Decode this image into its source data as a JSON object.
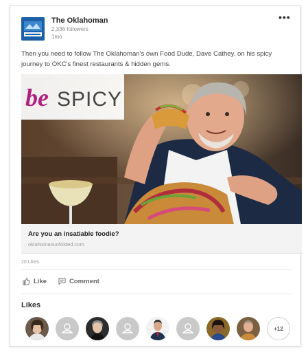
{
  "post": {
    "org_name": "The Oklahoman",
    "followers": "2,336 followers",
    "time": "1mo",
    "more_label": "•••",
    "text": "Then you need to follow The Oklahoman's own Food Dude, Dave Cathey, on his spicy journey to OKC's finest restaurants & hidden gems.",
    "logo_icon": "oklahoman-logo-icon"
  },
  "hero": {
    "brand_be": "be",
    "brand_spicy": "SPICY",
    "brand_be_color": "#b0207e"
  },
  "link_preview": {
    "title": "Are you an insatiable foodie?",
    "url": "oklahomanunfolded.com"
  },
  "social": {
    "likes_count": "20 Likes",
    "like_label": "Like",
    "comment_label": "Comment",
    "likes_title": "Likes",
    "more_likers": "+12"
  },
  "colors": {
    "card_border": "#d9d9d9",
    "logo_blue": "#1b5fa6",
    "muted_text": "#8a8a8a"
  }
}
